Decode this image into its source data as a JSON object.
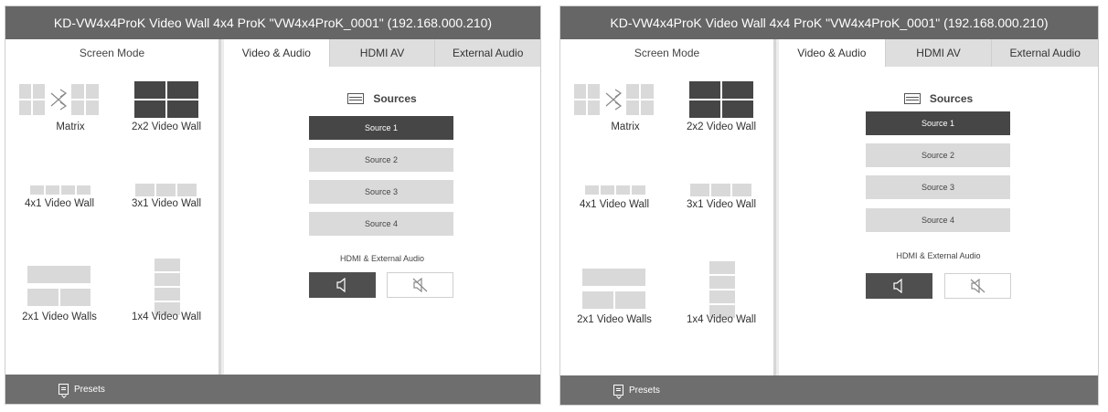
{
  "panels": [
    {
      "title": "KD-VW4x4ProK Video Wall 4x4 ProK \"VW4x4ProK_0001\" (192.168.000.210)",
      "screen_mode_title": "Screen Mode",
      "modes": [
        "Matrix",
        "2x2 Video Wall",
        "4x1 Video Wall",
        "3x1 Video Wall",
        "2x1 Video Walls",
        "1x4 Video Wall"
      ],
      "tabs": [
        "Video & Audio",
        "HDMI AV",
        "External Audio"
      ],
      "active_tab": "Video & Audio",
      "sources_title": "Sources",
      "sources": [
        "Source 1",
        "Source 2",
        "Source 3",
        "Source 4"
      ],
      "active_source": "Source 1",
      "audio_label": "HDMI & External Audio",
      "audio_state": "unmuted",
      "footer_label": "Presets"
    },
    {
      "title": "KD-VW4x4ProK Video Wall 4x4 ProK \"VW4x4ProK_0001\" (192.168.000.210)",
      "screen_mode_title": "Screen Mode",
      "modes": [
        "Matrix",
        "2x2 Video Wall",
        "4x1 Video Wall",
        "3x1 Video Wall",
        "2x1 Video Walls",
        "1x4 Video Wall"
      ],
      "tabs": [
        "Video & Audio",
        "HDMI AV",
        "External Audio"
      ],
      "active_tab": "Video & Audio",
      "sources_title": "Sources",
      "sources": [
        "Source 1",
        "Source 2",
        "Source 3",
        "Source 4"
      ],
      "active_source": "Source 1",
      "audio_label": "HDMI & External Audio",
      "audio_state": "unmuted",
      "footer_label": "Presets"
    }
  ],
  "icons": {
    "matrix": "matrix-switch-icon",
    "sources": "sources-icon",
    "speaker": "speaker-icon",
    "mute": "speaker-mute-icon",
    "presets": "presets-icon"
  },
  "colors": {
    "titlebar": "#666666",
    "footer": "#6e6e6e",
    "active": "#464646",
    "inactive_button": "#dadada",
    "tile": "#d9d9d9"
  }
}
